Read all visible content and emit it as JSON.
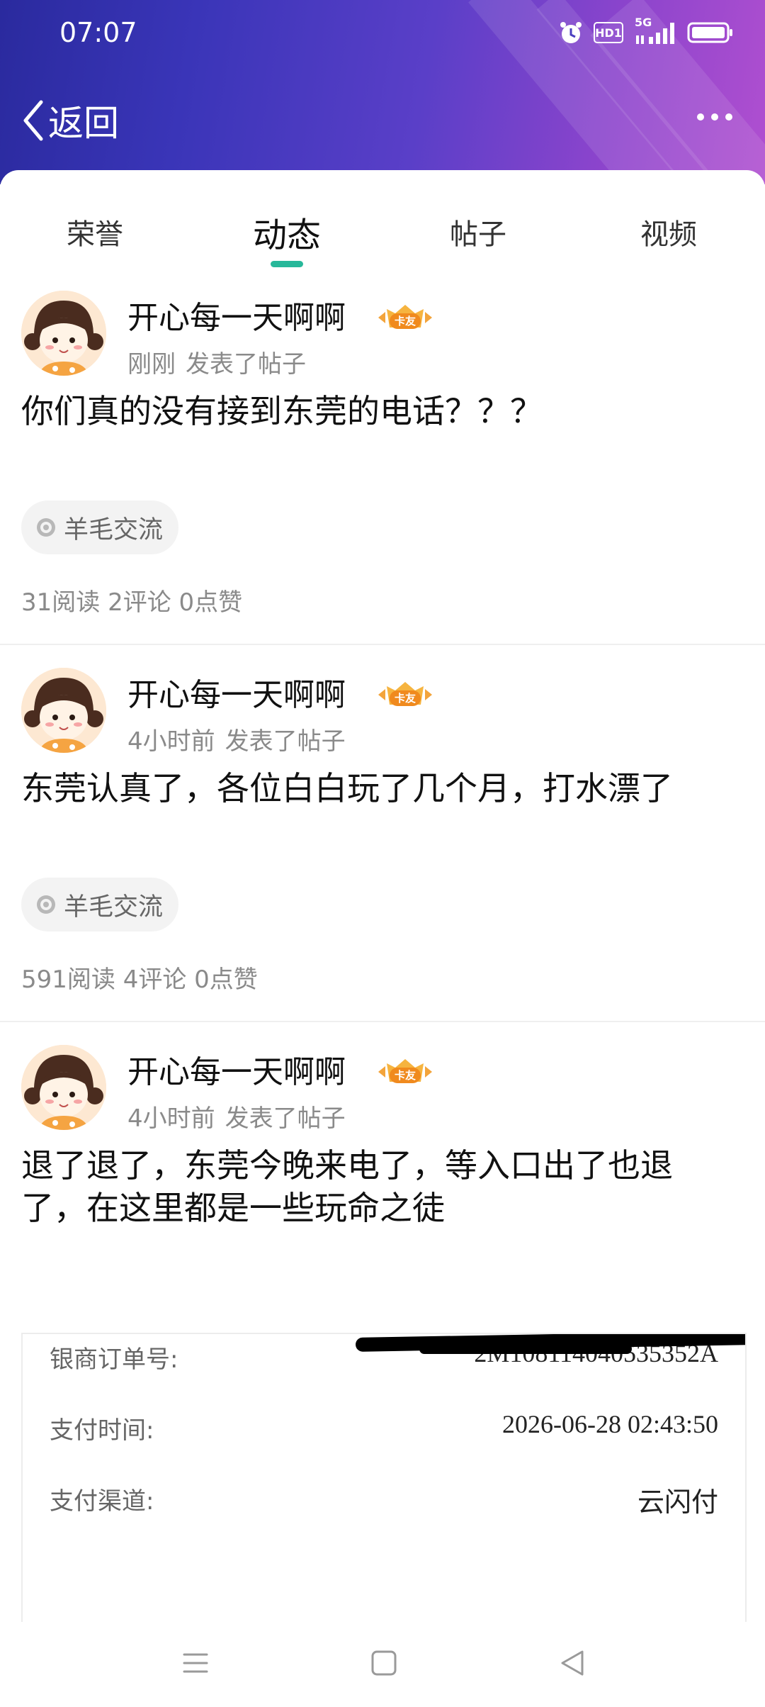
{
  "status_bar": {
    "time": "07:07",
    "network_label": "5G",
    "hd_label": "HD1"
  },
  "nav": {
    "back_label": "返回"
  },
  "tabs": [
    {
      "label": "荣誉",
      "active": false
    },
    {
      "label": "动态",
      "active": true
    },
    {
      "label": "帖子",
      "active": false
    },
    {
      "label": "视频",
      "active": false
    }
  ],
  "posts": [
    {
      "author": "开心每一天啊啊",
      "badge": "卡友",
      "time": "刚刚",
      "action": "发表了帖子",
      "text": "你们真的没有接到东莞的电话？？？",
      "topic": "羊毛交流",
      "stats": "31阅读 2评论 0点赞"
    },
    {
      "author": "开心每一天啊啊",
      "badge": "卡友",
      "time": "4小时前",
      "action": "发表了帖子",
      "text": "东莞认真了，各位白白玩了几个月，打水漂了",
      "topic": "羊毛交流",
      "stats": "591阅读 4评论 0点赞"
    },
    {
      "author": "开心每一天啊啊",
      "badge": "卡友",
      "time": "4小时前",
      "action": "发表了帖子",
      "text": "退了退了，东莞今晚来电了，等入口出了也退了，在这里都是一些玩命之徒"
    }
  ],
  "receipt": {
    "order_label": "银商订单号:",
    "order_value_visible": "2M108114040535352A",
    "pay_time_label": "支付时间:",
    "pay_time_value": "2026-06-28 02:43:50",
    "channel_label": "支付渠道:",
    "channel_value": "云闪付"
  },
  "colors": {
    "accent": "#27b89a",
    "header_start": "#2a2a9e",
    "header_end": "#b04fd0",
    "muted_text": "#8a8a8a"
  }
}
